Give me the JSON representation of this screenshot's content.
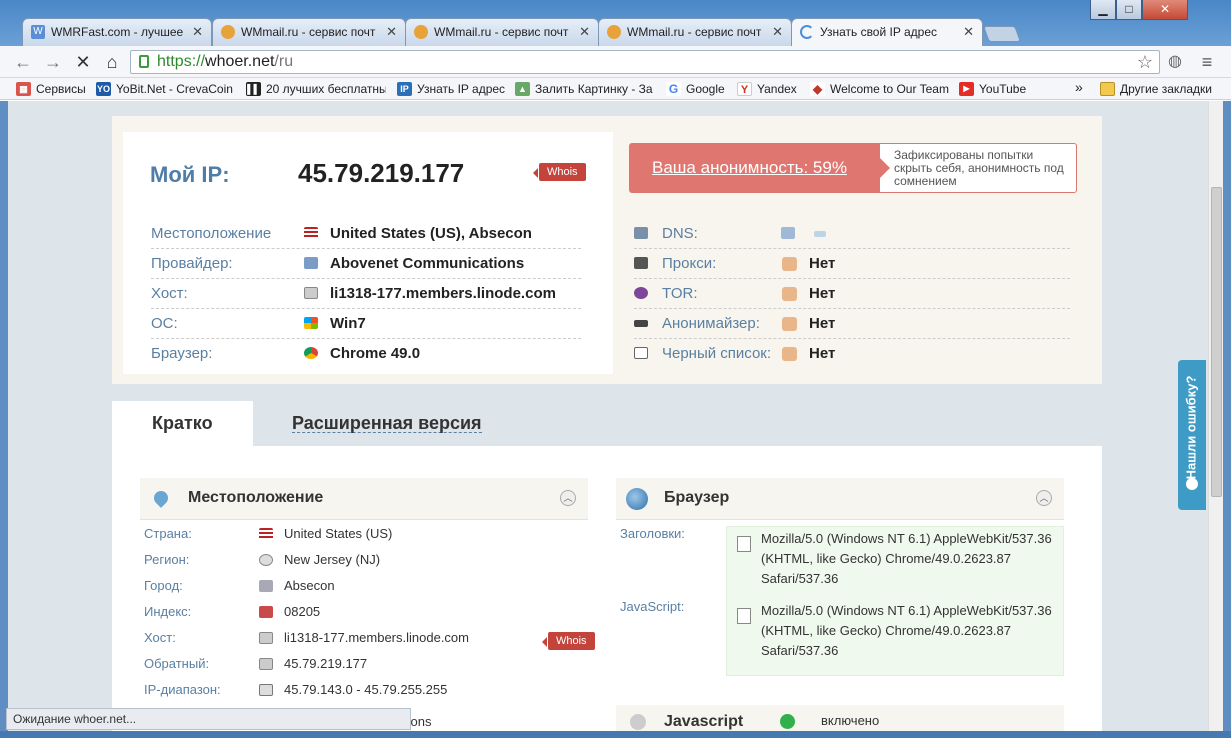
{
  "window": {
    "minimize": "▁",
    "maximize": "□",
    "close": "✕"
  },
  "tabs": [
    {
      "label": "WMRFast.com - лучшее",
      "icon_text": "W",
      "color": "#5b8ed6"
    },
    {
      "label": "WMmail.ru - сервис почт",
      "icon_text": "",
      "color": "#e8a23a"
    },
    {
      "label": "WMmail.ru - сервис почт",
      "icon_text": "",
      "color": "#e8a23a"
    },
    {
      "label": "WMmail.ru - сервис почт",
      "icon_text": "",
      "color": "#e8a23a"
    },
    {
      "label": "Узнать свой IP адрес",
      "icon_text": "",
      "color": "#4a90d9"
    }
  ],
  "tab_close": "✕",
  "address": {
    "scheme": "https://",
    "host": "whoer.net",
    "path": "/ru"
  },
  "nav": {
    "back": "←",
    "forward": "→",
    "stop": "✕",
    "home": "⌂",
    "star": "☆",
    "menu": "≡"
  },
  "bookmarks": [
    {
      "label": "Сервисы",
      "icon": "▦",
      "color": "#d9534f"
    },
    {
      "label": "YoBit.Net - CrevaCoin",
      "icon": "YO",
      "color": "#1d5aa8"
    },
    {
      "label": "20 лучших бесплатны",
      "icon": "▌▌",
      "color": "#222"
    },
    {
      "label": "Узнать IP адрес",
      "icon": "IP",
      "color": "#2a6fb8"
    },
    {
      "label": "Залить Картинку - За",
      "icon": "▲",
      "color": "#6aa86a"
    },
    {
      "label": "Google",
      "icon": "G",
      "color": "#4285f4"
    },
    {
      "label": "Yandex",
      "icon": "Y",
      "color": "#d52b1e"
    },
    {
      "label": "Welcome to Our Team",
      "icon": "◆",
      "color": "#c0392b"
    },
    {
      "label": "YouTube",
      "icon": "▶",
      "color": "#e52d27"
    }
  ],
  "bookmarks_more": "»",
  "other_bookmarks": "Другие закладки",
  "ip": {
    "label": "Мой IP:",
    "value": "45.79.219.177",
    "whois": "Whois"
  },
  "info_rows": [
    {
      "key": "Местоположение",
      "value": "United States (US), Absecon",
      "icon": "flag-us-icon"
    },
    {
      "key": "Провайдер:",
      "value": "Abovenet Communications",
      "icon": "provider-icon"
    },
    {
      "key": "Хост:",
      "value": "li1318-177.members.linode.com",
      "icon": "server-icon"
    },
    {
      "key": "ОС:",
      "value": "Win7",
      "icon": "windows-icon"
    },
    {
      "key": "Браузер:",
      "value": "Chrome 49.0",
      "icon": "chrome-icon"
    }
  ],
  "anonymity": {
    "label": "Ваша анонимность: 59%",
    "level_percent": 59,
    "note": "Зафиксированы попытки скрыть себя, анонимность под сомнением"
  },
  "checks": [
    {
      "key": "DNS:",
      "value": ""
    },
    {
      "key": "Прокси:",
      "value": "Нет"
    },
    {
      "key": "TOR:",
      "value": "Нет"
    },
    {
      "key": "Анонимайзер:",
      "value": "Нет"
    },
    {
      "key": "Черный список:",
      "value": "Нет"
    }
  ],
  "view_tabs": {
    "short": "Кратко",
    "extended": "Расширенная версия"
  },
  "location_panel": {
    "title": "Местоположение",
    "rows": [
      {
        "key": "Страна:",
        "value": "United States (US)"
      },
      {
        "key": "Регион:",
        "value": "New Jersey (NJ)"
      },
      {
        "key": "Город:",
        "value": "Absecon"
      },
      {
        "key": "Индекс:",
        "value": "08205"
      },
      {
        "key": "Хост:",
        "value": "li1318-177.members.linode.com"
      },
      {
        "key": "Обратный:",
        "value": "45.79.219.177"
      },
      {
        "key": "IP-диапазон:",
        "value": "45.79.143.0 - 45.79.255.255"
      }
    ],
    "whois": "Whois",
    "partial_row": "tions"
  },
  "browser_panel": {
    "title": "Браузер",
    "headers_label": "Заголовки:",
    "headers_value": "Mozilla/5.0 (Windows NT 6.1) AppleWebKit/537.36 (KHTML, like Gecko) Chrome/49.0.2623.87 Safari/537.36",
    "js_label": "JavaScript:",
    "js_value": "Mozilla/5.0 (Windows NT 6.1) AppleWebKit/537.36 (KHTML, like Gecko) Chrome/49.0.2623.87 Safari/537.36"
  },
  "javascript_panel": {
    "title": "Javascript",
    "status": "включено"
  },
  "feedback": "Нашли ошибку?",
  "status_bar": "Ожидание whoer.net..."
}
